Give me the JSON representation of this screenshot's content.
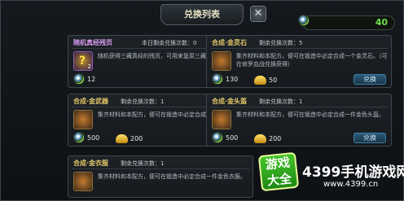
{
  "header": {
    "title": "兑换列表",
    "close_label": "✕",
    "currency_value": "40"
  },
  "cards": [
    {
      "title": "随机真经残页",
      "remain": "本日剩余兑换次数：0",
      "desc": "随机获得三藏真经的残页，可用来复原三藏真经",
      "icon_badge": "2",
      "cost1": "12",
      "cost2": "",
      "button": "兑换"
    },
    {
      "title": "合成·金灵石",
      "remain": "剩余兑换次数：5",
      "desc": "集齐材料和本配方，便可在锻造中必定合成一个金灵石。（可在修罗血战兑换获得）",
      "cost1": "130",
      "cost2": "50",
      "button": "兑换"
    },
    {
      "title": "合成·金武器",
      "remain": "剩余兑换次数：1",
      "desc": "集齐材料和本配方，便可在锻造中必定合成一件金色武器。",
      "cost1": "500",
      "cost2": "200",
      "button": "兑换"
    },
    {
      "title": "合成·金头盔",
      "remain": "剩余兑换次数：1",
      "desc": "集齐材料和本配方，便可在锻造中必定合成一件金色头盔。",
      "cost1": "500",
      "cost2": "200",
      "button": "兑换"
    },
    {
      "title": "合成·金衣服",
      "remain": "剩余兑换次数：1",
      "desc": "集齐材料和本配方，便可在锻造中必定合成一件金色衣服。"
    }
  ],
  "watermark": {
    "logo_line1": "游戏",
    "logo_line2": "大全",
    "main": "4399手机游戏网",
    "url": "www.4399.cn"
  },
  "icons": {
    "currency": "jade-coin-icon",
    "secondary_currency": "gold-ingot-icon"
  }
}
